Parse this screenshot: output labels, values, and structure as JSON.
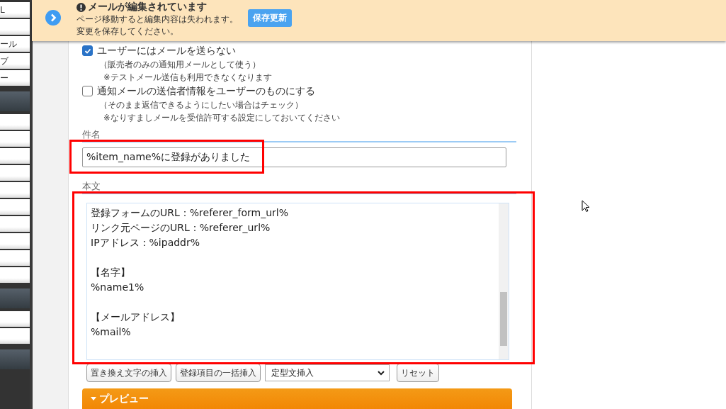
{
  "sidebar": {
    "items": [
      {
        "kind": "item",
        "label": "L"
      },
      {
        "kind": "item"
      },
      {
        "kind": "item",
        "label": "ール"
      },
      {
        "kind": "item",
        "label": "ブ"
      },
      {
        "kind": "item",
        "label": "ー"
      },
      {
        "kind": "header"
      },
      {
        "kind": "item"
      },
      {
        "kind": "item"
      },
      {
        "kind": "item"
      },
      {
        "kind": "item"
      },
      {
        "kind": "item"
      },
      {
        "kind": "item"
      },
      {
        "kind": "item"
      },
      {
        "kind": "item"
      },
      {
        "kind": "item"
      },
      {
        "kind": "item"
      },
      {
        "kind": "header"
      },
      {
        "kind": "item"
      },
      {
        "kind": "item"
      },
      {
        "kind": "header"
      }
    ]
  },
  "banner": {
    "title": "メールが編集されています",
    "message_lines": [
      "ページ移動すると編集内容は失われます。",
      "変更を保存してください。"
    ],
    "button": "保存更新"
  },
  "options": [
    {
      "label": "ユーザーにはメールを送らない",
      "checked": true,
      "notes": [
        "（販売者のみの通知用メールとして使う）",
        "※テストメール送信も利用できなくなります"
      ]
    },
    {
      "label": "通知メールの送信者情報をユーザーのものにする",
      "checked": false,
      "notes": [
        "（そのまま返信できるようにしたい場合はチェック）",
        "※なりすましメールを受信許可する設定にしておいてください"
      ]
    }
  ],
  "subject": {
    "label": "件名",
    "value": "%item_name%に登録がありました"
  },
  "body": {
    "label": "本文",
    "value": "登録フォームのURL：%referer_form_url%\nリンク元ページのURL：%referer_url%\nIPアドレス：%ipaddr%\n\n【名字】\n%name1%\n\n【メールアドレス】\n%mail%"
  },
  "toolbar": {
    "buttons": [
      "置き換え文字の挿入",
      "登録項目の一括挿入"
    ],
    "select": "定型文挿入",
    "reset": "リセット"
  },
  "preview": {
    "label": "プレビュー"
  }
}
